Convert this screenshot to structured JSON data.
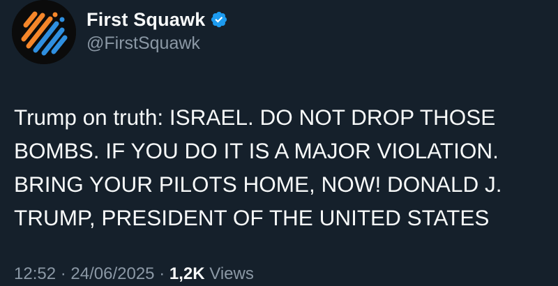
{
  "author": {
    "display_name": "First Squawk",
    "handle": "@FirstSquawk",
    "verified": true,
    "verified_color": "#1d9bf0",
    "avatar_colors": [
      "#f5862a",
      "#2f8fe0"
    ]
  },
  "tweet": {
    "lines": [
      "Trump on truth: ISRAEL. DO NOT DROP THOSE",
      "BOMBS. IF YOU DO IT IS A MAJOR VIOLATION.",
      "BRING YOUR PILOTS HOME, NOW! DONALD J.",
      "TRUMP, PRESIDENT OF THE UNITED STATES"
    ]
  },
  "meta": {
    "time": "12:52",
    "separator": "·",
    "date": "24/06/2025",
    "views_count": "1,2K",
    "views_label": "Views"
  },
  "colors": {
    "background": "#15202b",
    "text_primary": "#f7f9f9",
    "text_secondary": "#8b98a5"
  }
}
